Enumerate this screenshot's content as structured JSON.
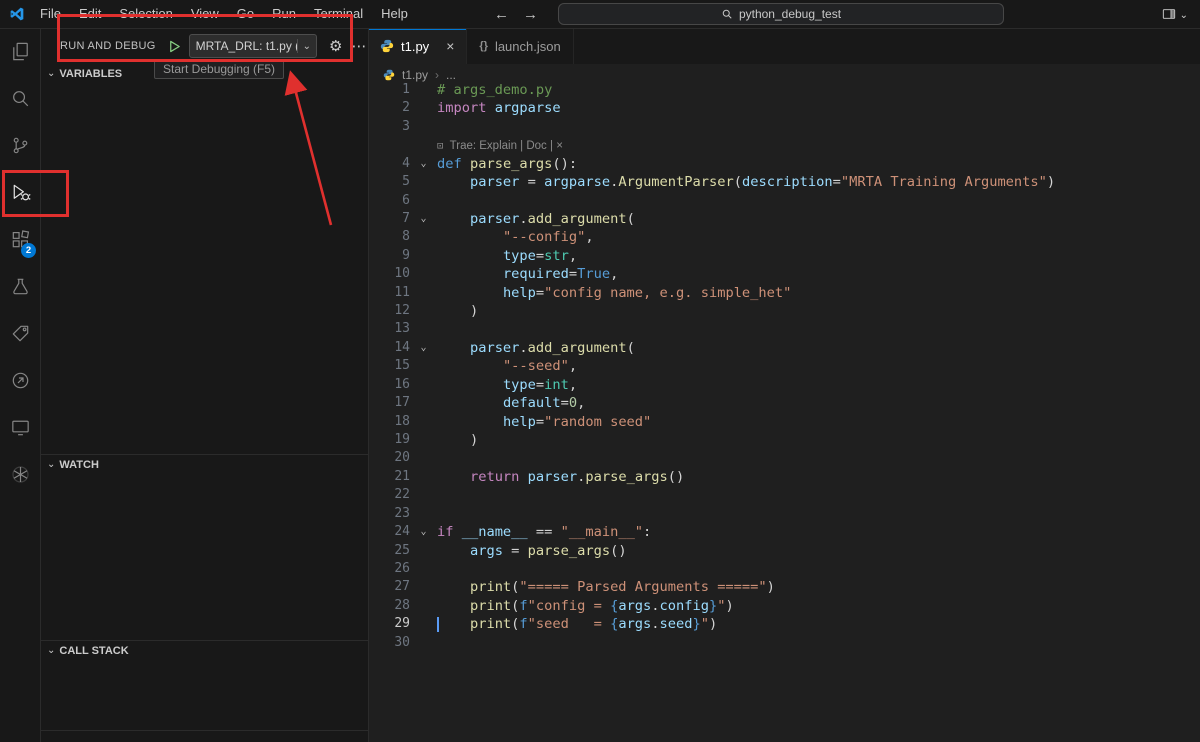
{
  "title_bar": {
    "menus": [
      "File",
      "Edit",
      "Selection",
      "View",
      "Go",
      "Run",
      "Terminal",
      "Help"
    ],
    "search_query": "python_debug_test"
  },
  "activity_bar": {
    "items": [
      "explorer",
      "search",
      "source-control",
      "run-and-debug",
      "extensions",
      "testing",
      "tags",
      "share",
      "screen",
      "assistant"
    ],
    "active_item": "run-and-debug",
    "extensions_badge": "2"
  },
  "debug_sidebar": {
    "title": "RUN AND DEBUG",
    "config_selector": "MRTA_DRL: t1.py (",
    "tooltip": "Start Debugging (F5)",
    "sections": {
      "variables": "VARIABLES",
      "watch": "WATCH",
      "call_stack": "CALL STACK"
    }
  },
  "icons": {
    "close": "×",
    "chevron_down": "⌄",
    "gear": "⚙",
    "ellipsis": "⋯",
    "braces": "{}",
    "breadcrumb_sep": "›",
    "back_arrow": "←",
    "forward_arrow": "→"
  },
  "editor": {
    "tabs": [
      {
        "label": "t1.py",
        "active": true
      },
      {
        "label": "launch.json",
        "active": false
      }
    ],
    "breadcrumb": {
      "file": "t1.py",
      "more": "..."
    },
    "code_lens": "Trae: Explain | Doc | ×",
    "lines": [
      {
        "n": 1,
        "t": [
          [
            "cm",
            "# args_demo.py"
          ]
        ]
      },
      {
        "n": 2,
        "t": [
          [
            "kw",
            "import"
          ],
          [
            "pl",
            " "
          ],
          [
            "var",
            "argparse"
          ]
        ]
      },
      {
        "n": 3,
        "t": []
      },
      {
        "lens": true,
        "t": [
          [
            "lensicon",
            "⊡ "
          ],
          [
            "lens",
            "Trae: Explain | Doc | ×"
          ]
        ]
      },
      {
        "n": 4,
        "fold": true,
        "t": [
          [
            "kb",
            "def"
          ],
          [
            "pl",
            " "
          ],
          [
            "fn",
            "parse_args"
          ],
          [
            "pl",
            "():"
          ]
        ]
      },
      {
        "n": 5,
        "t": [
          [
            "pl",
            "    "
          ],
          [
            "var",
            "parser"
          ],
          [
            "pl",
            " = "
          ],
          [
            "var",
            "argparse"
          ],
          [
            "pl",
            "."
          ],
          [
            "fn",
            "ArgumentParser"
          ],
          [
            "pl",
            "("
          ],
          [
            "var",
            "description"
          ],
          [
            "pl",
            "="
          ],
          [
            "str",
            "\"MRTA Training Arguments\""
          ],
          [
            "pl",
            ")"
          ]
        ]
      },
      {
        "n": 6,
        "t": []
      },
      {
        "n": 7,
        "fold": true,
        "t": [
          [
            "pl",
            "    "
          ],
          [
            "var",
            "parser"
          ],
          [
            "pl",
            "."
          ],
          [
            "fn",
            "add_argument"
          ],
          [
            "pl",
            "("
          ]
        ]
      },
      {
        "n": 8,
        "t": [
          [
            "pl",
            "        "
          ],
          [
            "str",
            "\"--config\""
          ],
          [
            "pl",
            ","
          ]
        ]
      },
      {
        "n": 9,
        "t": [
          [
            "pl",
            "        "
          ],
          [
            "var",
            "type"
          ],
          [
            "pl",
            "="
          ],
          [
            "cls",
            "str"
          ],
          [
            "pl",
            ","
          ]
        ]
      },
      {
        "n": 10,
        "t": [
          [
            "pl",
            "        "
          ],
          [
            "var",
            "required"
          ],
          [
            "pl",
            "="
          ],
          [
            "kb",
            "True"
          ],
          [
            "pl",
            ","
          ]
        ]
      },
      {
        "n": 11,
        "t": [
          [
            "pl",
            "        "
          ],
          [
            "var",
            "help"
          ],
          [
            "pl",
            "="
          ],
          [
            "str",
            "\"config name, e.g. simple_het\""
          ]
        ]
      },
      {
        "n": 12,
        "t": [
          [
            "pl",
            "    )"
          ]
        ]
      },
      {
        "n": 13,
        "t": []
      },
      {
        "n": 14,
        "fold": true,
        "t": [
          [
            "pl",
            "    "
          ],
          [
            "var",
            "parser"
          ],
          [
            "pl",
            "."
          ],
          [
            "fn",
            "add_argument"
          ],
          [
            "pl",
            "("
          ]
        ]
      },
      {
        "n": 15,
        "t": [
          [
            "pl",
            "        "
          ],
          [
            "str",
            "\"--seed\""
          ],
          [
            "pl",
            ","
          ]
        ]
      },
      {
        "n": 16,
        "t": [
          [
            "pl",
            "        "
          ],
          [
            "var",
            "type"
          ],
          [
            "pl",
            "="
          ],
          [
            "cls",
            "int"
          ],
          [
            "pl",
            ","
          ]
        ]
      },
      {
        "n": 17,
        "t": [
          [
            "pl",
            "        "
          ],
          [
            "var",
            "default"
          ],
          [
            "pl",
            "="
          ],
          [
            "num",
            "0"
          ],
          [
            "pl",
            ","
          ]
        ]
      },
      {
        "n": 18,
        "t": [
          [
            "pl",
            "        "
          ],
          [
            "var",
            "help"
          ],
          [
            "pl",
            "="
          ],
          [
            "str",
            "\"random seed\""
          ]
        ]
      },
      {
        "n": 19,
        "t": [
          [
            "pl",
            "    )"
          ]
        ]
      },
      {
        "n": 20,
        "t": []
      },
      {
        "n": 21,
        "t": [
          [
            "pl",
            "    "
          ],
          [
            "kw",
            "return"
          ],
          [
            "pl",
            " "
          ],
          [
            "var",
            "parser"
          ],
          [
            "pl",
            "."
          ],
          [
            "fn",
            "parse_args"
          ],
          [
            "pl",
            "()"
          ]
        ]
      },
      {
        "n": 22,
        "t": []
      },
      {
        "n": 23,
        "t": []
      },
      {
        "n": 24,
        "fold": true,
        "t": [
          [
            "kw",
            "if"
          ],
          [
            "pl",
            " "
          ],
          [
            "var",
            "__name__"
          ],
          [
            "pl",
            " == "
          ],
          [
            "str",
            "\"__main__\""
          ],
          [
            "pl",
            ":"
          ]
        ]
      },
      {
        "n": 25,
        "t": [
          [
            "pl",
            "    "
          ],
          [
            "var",
            "args"
          ],
          [
            "pl",
            " = "
          ],
          [
            "fn",
            "parse_args"
          ],
          [
            "pl",
            "()"
          ]
        ]
      },
      {
        "n": 26,
        "t": []
      },
      {
        "n": 27,
        "t": [
          [
            "pl",
            "    "
          ],
          [
            "fn",
            "print"
          ],
          [
            "pl",
            "("
          ],
          [
            "str",
            "\"===== Parsed Arguments =====\""
          ],
          [
            "pl",
            ")"
          ]
        ]
      },
      {
        "n": 28,
        "t": [
          [
            "pl",
            "    "
          ],
          [
            "fn",
            "print"
          ],
          [
            "pl",
            "("
          ],
          [
            "kb",
            "f"
          ],
          [
            "str",
            "\"config = "
          ],
          [
            "kb",
            "{"
          ],
          [
            "var",
            "args"
          ],
          [
            "pl",
            "."
          ],
          [
            "var",
            "config"
          ],
          [
            "kb",
            "}"
          ],
          [
            "str",
            "\""
          ],
          [
            "pl",
            ")"
          ]
        ]
      },
      {
        "n": 29,
        "active": true,
        "cursor": true,
        "t": [
          [
            "pl",
            "    "
          ],
          [
            "fn",
            "print"
          ],
          [
            "pl",
            "("
          ],
          [
            "kb",
            "f"
          ],
          [
            "str",
            "\"seed   = "
          ],
          [
            "kb",
            "{"
          ],
          [
            "var",
            "args"
          ],
          [
            "pl",
            "."
          ],
          [
            "var",
            "seed"
          ],
          [
            "kb",
            "}"
          ],
          [
            "str",
            "\""
          ],
          [
            "pl",
            ")"
          ]
        ]
      },
      {
        "n": 30,
        "t": []
      }
    ]
  },
  "annotations": {
    "color": "#e0302e"
  }
}
